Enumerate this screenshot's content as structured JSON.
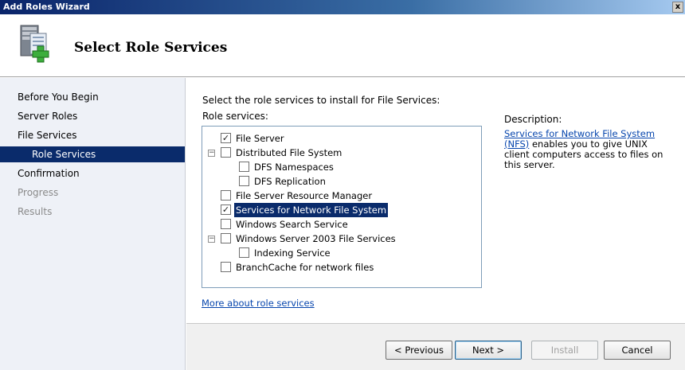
{
  "window": {
    "title": "Add Roles Wizard",
    "close_glyph": "x"
  },
  "header": {
    "title": "Select Role Services",
    "icon": "server-add-icon"
  },
  "sidebar": {
    "items": [
      {
        "label": "Before You Begin",
        "state": "normal"
      },
      {
        "label": "Server Roles",
        "state": "normal"
      },
      {
        "label": "File Services",
        "state": "normal"
      },
      {
        "label": "Role Services",
        "state": "active"
      },
      {
        "label": "Confirmation",
        "state": "normal"
      },
      {
        "label": "Progress",
        "state": "disabled"
      },
      {
        "label": "Results",
        "state": "disabled"
      }
    ]
  },
  "main": {
    "instruction": "Select the role services to install for File Services:",
    "role_services_label": "Role services:",
    "tree": [
      {
        "label": "File Server",
        "checked": true,
        "expander": ""
      },
      {
        "label": "Distributed File System",
        "checked": false,
        "expander": "−"
      },
      {
        "label": "DFS Namespaces",
        "checked": false,
        "expander": ""
      },
      {
        "label": "DFS Replication",
        "checked": false,
        "expander": ""
      },
      {
        "label": "File Server Resource Manager",
        "checked": false,
        "expander": ""
      },
      {
        "label": "Services for Network File System",
        "checked": true,
        "expander": "",
        "selected": true
      },
      {
        "label": "Windows Search Service",
        "checked": false,
        "expander": ""
      },
      {
        "label": "Windows Server 2003 File Services",
        "checked": false,
        "expander": "−"
      },
      {
        "label": "Indexing Service",
        "checked": false,
        "expander": ""
      },
      {
        "label": "BranchCache for network files",
        "checked": false,
        "expander": ""
      }
    ],
    "description_title": "Description:",
    "description_link": "Services for Network File System (NFS)",
    "description_text": " enables you to give UNIX client computers access to files on this server.",
    "more_link": "More about role services"
  },
  "footer": {
    "previous": "< Previous",
    "next": "Next >",
    "install": "Install",
    "cancel": "Cancel"
  },
  "colors": {
    "accent": "#0a2b6b",
    "link": "#0645ad"
  }
}
